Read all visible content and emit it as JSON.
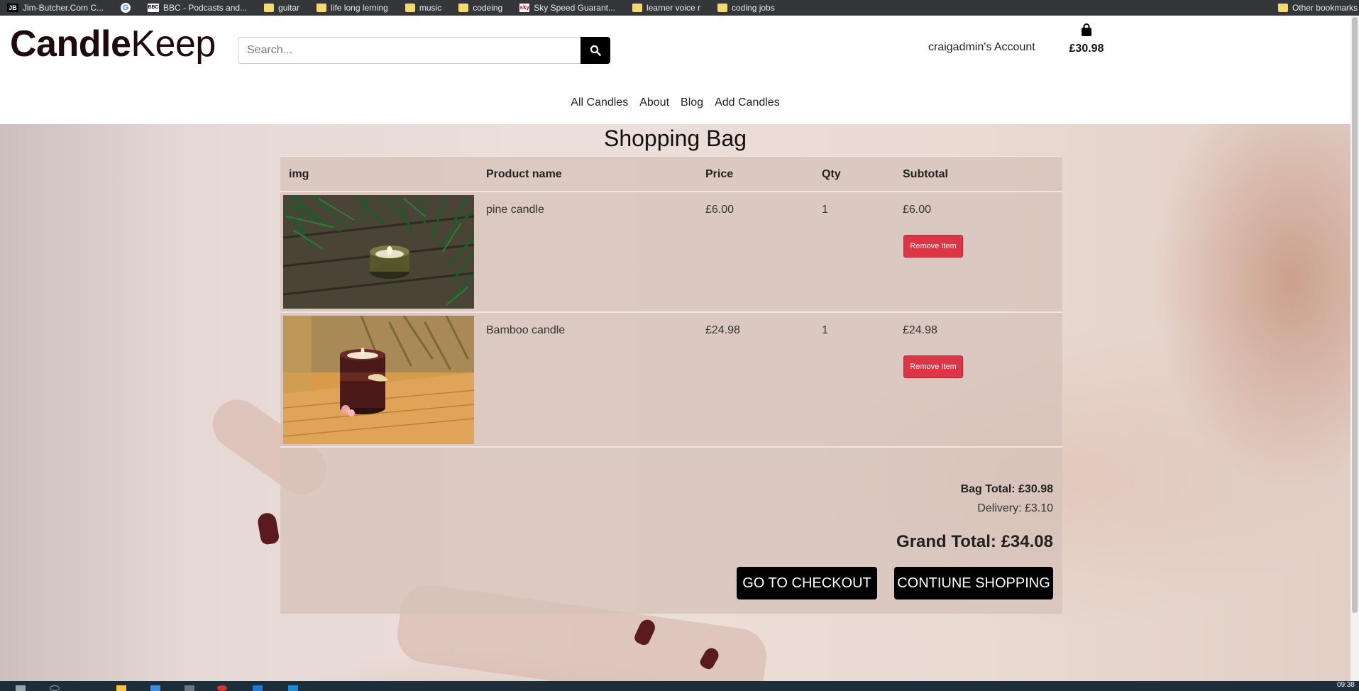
{
  "bookmarks": [
    {
      "label": "Jim-Butcher.Com C...",
      "icon": "jb-icon"
    },
    {
      "label": "",
      "icon": "google-icon"
    },
    {
      "label": "BBC - Podcasts and...",
      "icon": "bbc-icon"
    },
    {
      "label": "guitar",
      "icon": "folder-icon"
    },
    {
      "label": "life long lerning",
      "icon": "folder-icon"
    },
    {
      "label": "music",
      "icon": "folder-icon"
    },
    {
      "label": "codeing",
      "icon": "folder-icon"
    },
    {
      "label": "Sky Speed Guarant...",
      "icon": "sky-icon"
    },
    {
      "label": "learner voice r",
      "icon": "folder-icon"
    },
    {
      "label": "coding jobs",
      "icon": "folder-icon"
    }
  ],
  "other_bookmarks": "Other bookmarks",
  "header": {
    "logo_bold": "Candle",
    "logo_light": "Keep",
    "search_placeholder": "Search...",
    "account": "craigadmin's Account",
    "bag_total": "£30.98"
  },
  "nav": [
    "All Candles",
    "About",
    "Blog",
    "Add Candles"
  ],
  "page_title": "Shopping Bag",
  "table": {
    "columns": [
      "img",
      "Product name",
      "Price",
      "Qty",
      "Subtotal"
    ],
    "rows": [
      {
        "name": "pine candle",
        "price": "£6.00",
        "qty": "1",
        "subtotal": "£6.00",
        "remove": "Remove Item"
      },
      {
        "name": "Bamboo candle",
        "price": "£24.98",
        "qty": "1",
        "subtotal": "£24.98",
        "remove": "Remove Item"
      }
    ]
  },
  "totals": {
    "bag_total": "Bag Total: £30.98",
    "delivery": "Delivery: £3.10",
    "grand_total": "Grand Total: £34.08"
  },
  "buttons": {
    "checkout": "GO TO CHECKOUT",
    "continue": "CONTIUNE SHOPPING"
  },
  "clock": "09:38",
  "colors": {
    "brand": "#1f0a0d",
    "remove_button": "#dc3545",
    "primary_button": "#000000",
    "bookmarks_bar": "#35363a"
  }
}
